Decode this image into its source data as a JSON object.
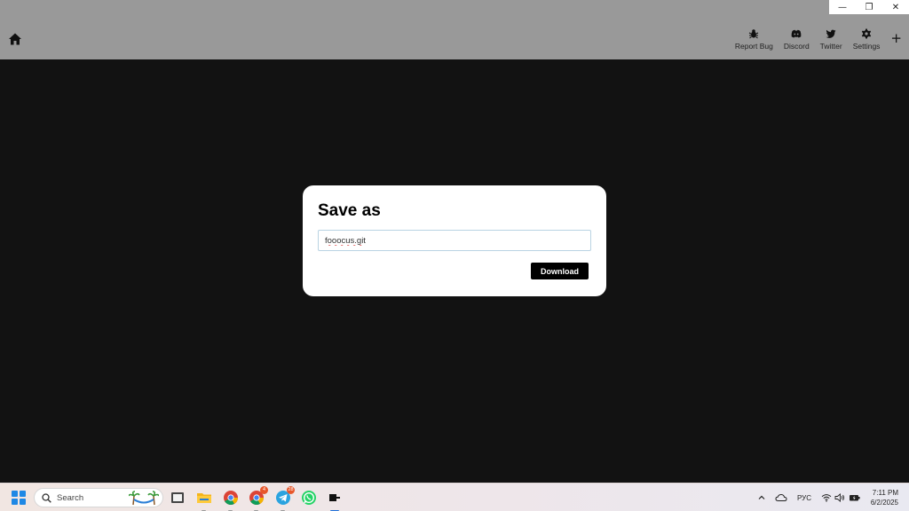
{
  "window": {
    "minimize_glyph": "—",
    "restore_glyph": "❐",
    "close_glyph": "✕"
  },
  "header": {
    "home_icon": "home-icon",
    "nav": [
      {
        "label": "Report Bug",
        "icon": "bug-icon"
      },
      {
        "label": "Discord",
        "icon": "discord-icon"
      },
      {
        "label": "Twitter",
        "icon": "twitter-icon"
      },
      {
        "label": "Settings",
        "icon": "gear-icon"
      }
    ],
    "plus_glyph": "+"
  },
  "dialog": {
    "title": "Save as",
    "filename_value": "fooocus.git",
    "download_label": "Download"
  },
  "taskbar": {
    "search_placeholder": "Search",
    "apps": [
      {
        "name": "file-explorer-icon",
        "badge": ""
      },
      {
        "name": "files-folder-icon",
        "badge": ""
      },
      {
        "name": "chrome-icon",
        "badge": ""
      },
      {
        "name": "chrome-profile-icon",
        "badge": "4"
      },
      {
        "name": "telegram-icon",
        "badge": "28"
      },
      {
        "name": "whatsapp-icon",
        "badge": ""
      },
      {
        "name": "terminal-app-icon",
        "badge": ""
      }
    ],
    "tray": {
      "chevron": "^",
      "language": "РУС"
    },
    "clock": {
      "time": "7:11 PM",
      "date": "6/2/2025"
    }
  },
  "colors": {
    "header_bg": "#999999",
    "main_bg": "#121212",
    "dialog_bg": "#ffffff",
    "button_bg": "#000000",
    "input_border": "#b9d3e3",
    "windows_blue": "#1e88e5"
  }
}
